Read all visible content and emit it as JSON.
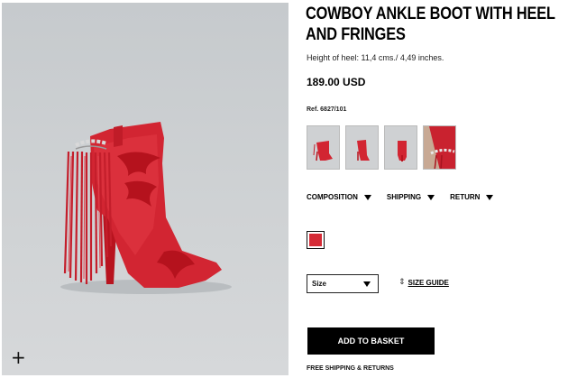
{
  "product": {
    "title": "COWBOY ANKLE BOOT WITH HEEL AND FRINGES",
    "heel_height": "Height of heel: 11,4 cms./ 4,49 inches.",
    "price": "189.00 USD",
    "ref": "Ref. 6827/101"
  },
  "image": {
    "zoom_label": "+"
  },
  "tabs": [
    {
      "label": "COMPOSITION"
    },
    {
      "label": "SHIPPING"
    },
    {
      "label": "RETURN"
    }
  ],
  "color_swatch": "#d62b36",
  "size": {
    "selected": "Size"
  },
  "size_guide": {
    "icon": "ruler-icon",
    "label": "SIZE GUIDE"
  },
  "actions": {
    "add_to_basket": "ADD TO BASKET"
  },
  "footer": {
    "shipping_returns": "FREE SHIPPING & RETURNS"
  }
}
